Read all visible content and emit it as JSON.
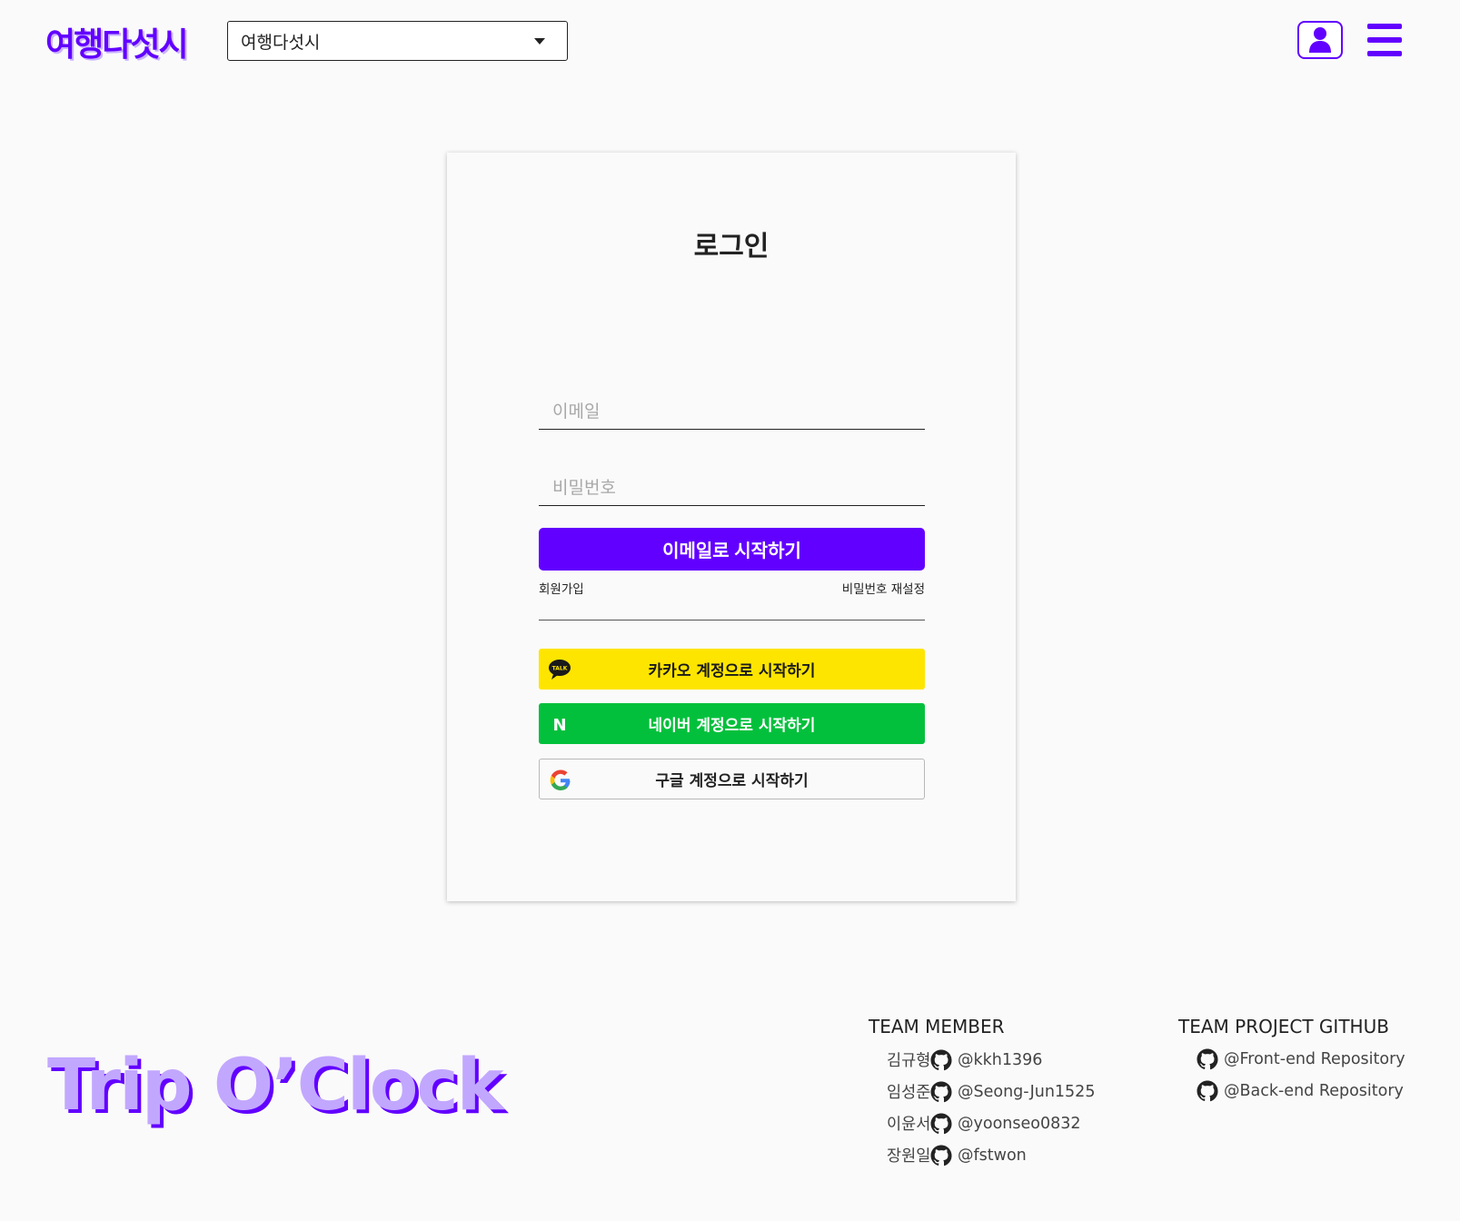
{
  "header": {
    "logo_text": "여행다섯시",
    "select_value": "여행다섯시",
    "icons": {
      "user": "user-icon",
      "menu": "hamburger-menu-icon",
      "dropdown": "caret-down-icon"
    }
  },
  "login": {
    "title": "로그인",
    "email_placeholder": "이메일",
    "password_placeholder": "비밀번호",
    "submit_label": "이메일로 시작하기",
    "signup_label": "회원가입",
    "reset_label": "비밀번호 재설정",
    "kakao_label": "카카오 계정으로 시작하기",
    "kakao_icon_text": "TALK",
    "naver_label": "네이버 계정으로 시작하기",
    "naver_icon_text": "N",
    "google_label": "구글 계정으로 시작하기"
  },
  "footer": {
    "logo_text": "Trip O’Clock",
    "team_heading": "TEAM MEMBER",
    "repo_heading": "TEAM PROJECT GITHUB",
    "members": [
      {
        "name": "김규형",
        "handle": "@kkh1396"
      },
      {
        "name": "임성준",
        "handle": "@Seong-Jun1525"
      },
      {
        "name": "이윤서",
        "handle": "@yoonseo0832"
      },
      {
        "name": "장원일",
        "handle": "@fstwon"
      }
    ],
    "repos": [
      {
        "label": "@Front-end Repository"
      },
      {
        "label": "@Back-end Repository"
      }
    ]
  },
  "colors": {
    "brand": "#6200ff",
    "brand_light": "#c2a7ff",
    "kakao": "#fee500",
    "naver": "#03c03c",
    "background": "#fafafa"
  }
}
